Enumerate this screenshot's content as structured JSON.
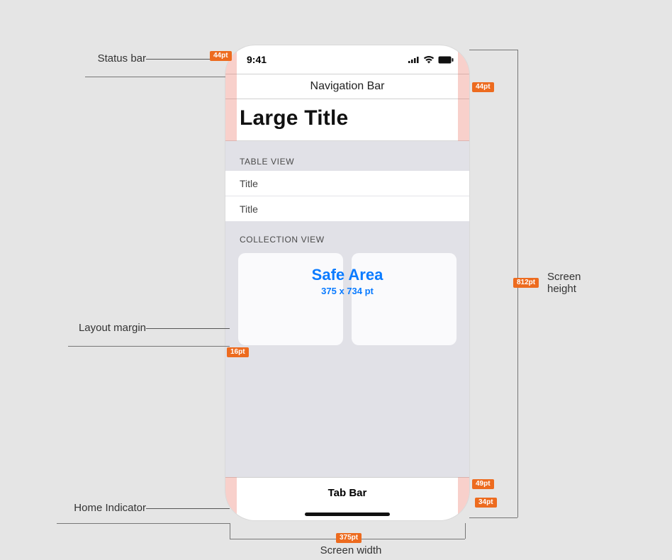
{
  "statusBar": {
    "time": "9:41"
  },
  "navBar": {
    "title": "Navigation Bar"
  },
  "largeTitle": "Large Title",
  "tableView": {
    "header": "TABLE VIEW",
    "rows": [
      "Title",
      "Title"
    ]
  },
  "collectionView": {
    "header": "COLLECTION VIEW"
  },
  "safeArea": {
    "title": "Safe Area",
    "dim": "375 x 734 pt"
  },
  "tabBar": {
    "title": "Tab Bar"
  },
  "callouts": {
    "statusBar": "Status bar",
    "layoutMargin": "Layout margin",
    "homeIndicator": "Home Indicator",
    "screenHeight": "Screen height",
    "screenWidth": "Screen width"
  },
  "badges": {
    "statusBar": "44pt",
    "navBar": "44pt",
    "layoutMargin": "16pt",
    "screenHeight": "812pt",
    "tabBar": "49pt",
    "homeIndicator": "34pt",
    "screenWidth": "375pt"
  }
}
